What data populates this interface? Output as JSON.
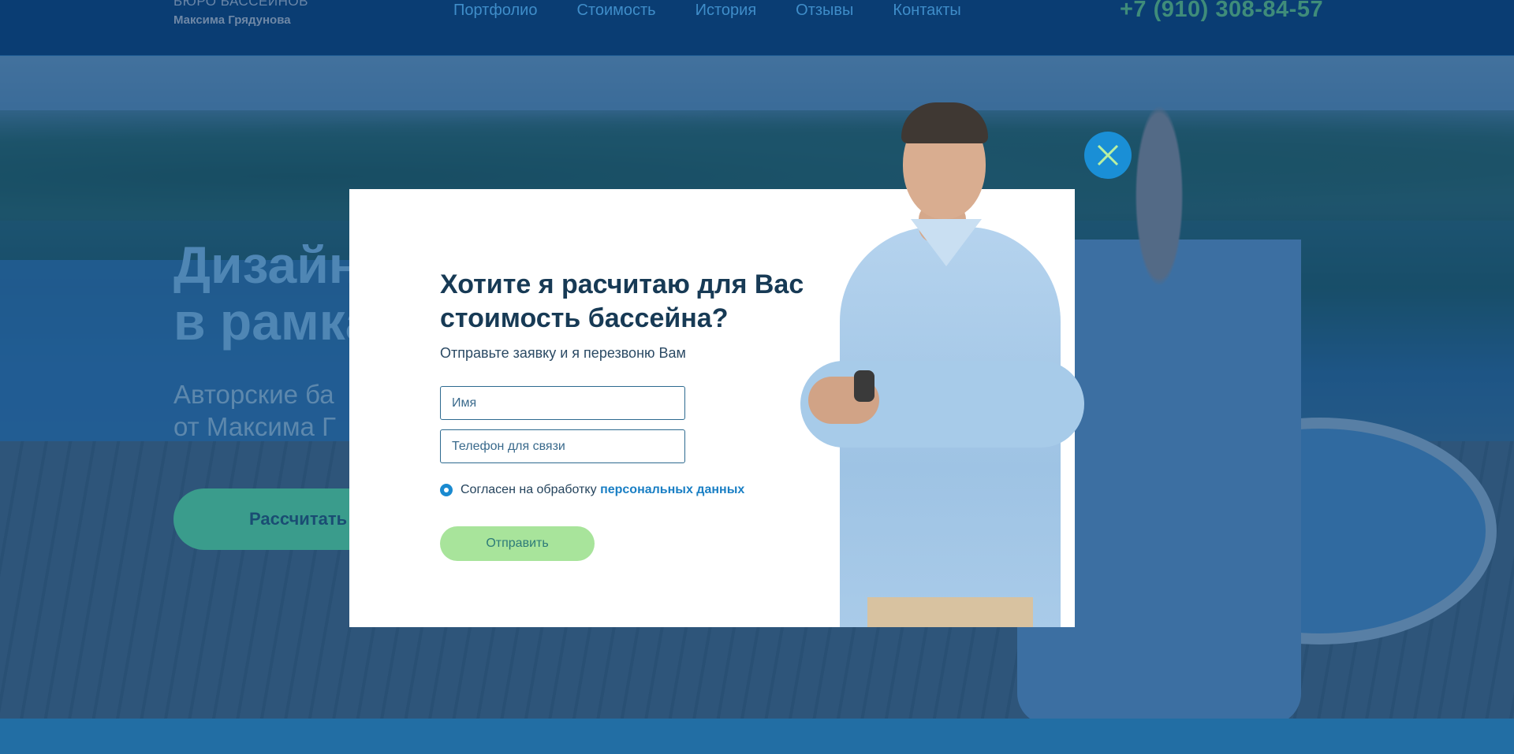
{
  "header": {
    "logo_line1": "БЮРО БАССЕЙНОВ",
    "logo_line2": "Максима Грядунова",
    "nav": [
      "Портфолио",
      "Стоимость",
      "История",
      "Отзывы",
      "Контакты"
    ],
    "phone": "+7 (910) 308-84-57"
  },
  "hero": {
    "title_line1": "Дизайн",
    "title_line2": "в рамка",
    "subtitle_line1": "Авторские ба",
    "subtitle_line2": "от Максима Г",
    "cta_label": "Рассчитать"
  },
  "modal": {
    "title": "Хотите я расчитаю для Вас стоимость бассейна?",
    "subtitle": "Отправьте заявку и я перезвоню Вам",
    "name_placeholder": "Имя",
    "phone_placeholder": "Телефон для связи",
    "consent_text": "Согласен на обработку",
    "consent_link": "персональных данных",
    "submit_label": "Отправить",
    "close_icon": "close-icon"
  },
  "colors": {
    "accent_blue": "#1a8fd6",
    "submit_green": "#a8e49b",
    "title_dark": "#173a55",
    "overlay": "#0a4682"
  }
}
